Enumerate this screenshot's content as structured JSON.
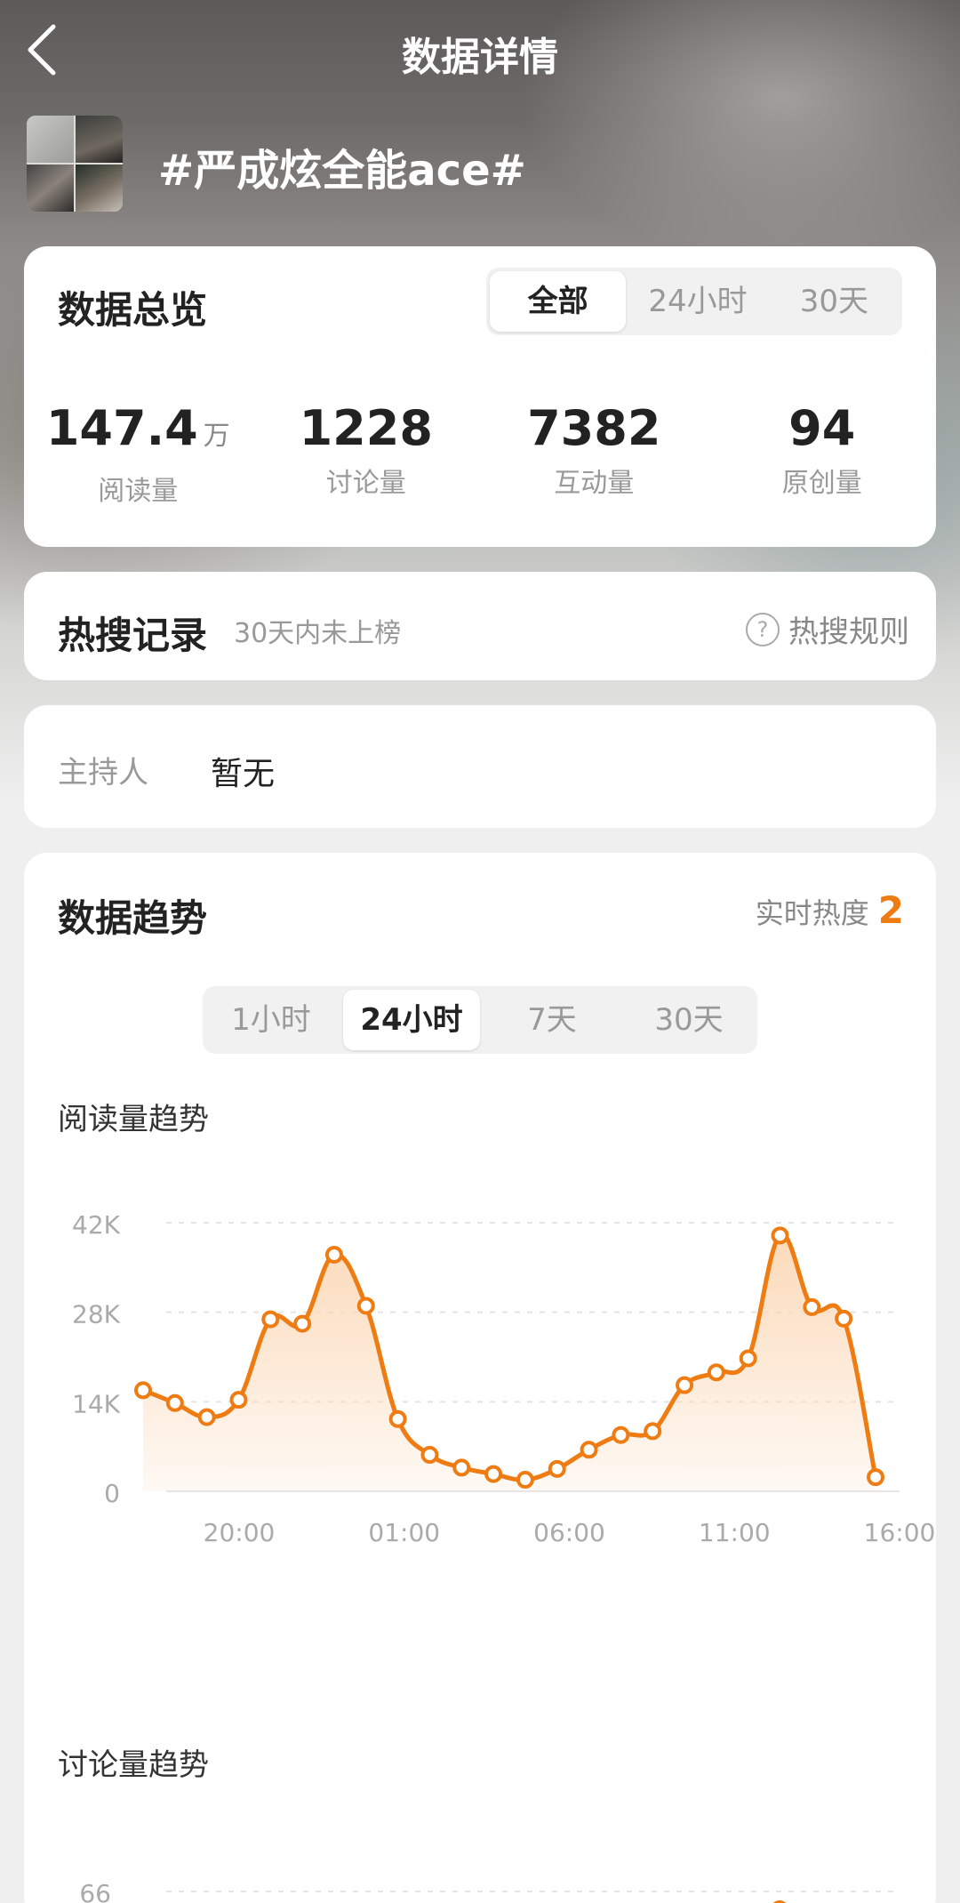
{
  "header": {
    "title": "数据详情"
  },
  "topic": {
    "name": "#严成炫全能ace#"
  },
  "overview": {
    "title": "数据总览",
    "tabs": [
      "全部",
      "24小时",
      "30天"
    ],
    "active_tab": "全部",
    "stats": [
      {
        "value": "147.4",
        "unit": "万",
        "label": "阅读量"
      },
      {
        "value": "1228",
        "unit": "",
        "label": "讨论量"
      },
      {
        "value": "7382",
        "unit": "",
        "label": "互动量"
      },
      {
        "value": "94",
        "unit": "",
        "label": "原创量"
      }
    ]
  },
  "hot_search": {
    "title": "热搜记录",
    "note": "30天内未上榜",
    "rules_label": "热搜规则",
    "help_glyph": "?"
  },
  "host": {
    "label": "主持人",
    "value": "暂无"
  },
  "trend": {
    "title": "数据趋势",
    "heat_label": "实时热度",
    "heat_value": "2",
    "tabs": [
      "1小时",
      "24小时",
      "7天",
      "30天"
    ],
    "active_tab": "24小时",
    "read_title": "阅读量趋势",
    "discussion_title": "讨论量趋势"
  },
  "colors": {
    "accent": "#ee7c12",
    "fill": "#fbd8b6"
  },
  "chart_data": [
    {
      "type": "area",
      "title": "阅读量趋势",
      "ylim": [
        0,
        42000
      ],
      "y_ticks": [
        0,
        14000,
        28000,
        42000
      ],
      "y_tick_labels": [
        "0",
        "14K",
        "28K",
        "42K"
      ],
      "x_tick_labels": [
        "20:00",
        "01:00",
        "06:00",
        "11:00",
        "16:00"
      ],
      "series": [
        {
          "values": [
            15800,
            13800,
            11600,
            14300,
            26900,
            26200,
            37000,
            29000,
            11300,
            5700,
            3700,
            2700,
            1800,
            3500,
            6500,
            8800,
            9400,
            16600,
            18600,
            20800,
            40000,
            28800,
            27000,
            2200
          ]
        }
      ]
    },
    {
      "type": "area",
      "title": "讨论量趋势",
      "y_tick_labels": [
        "66"
      ],
      "series": [
        {
          "values": []
        }
      ]
    }
  ]
}
